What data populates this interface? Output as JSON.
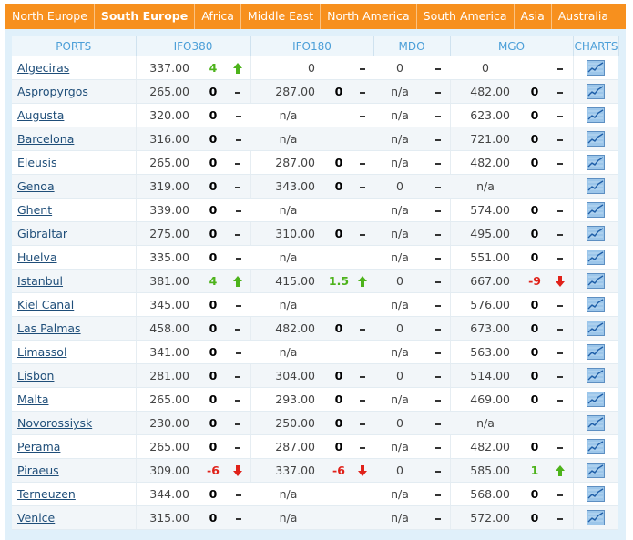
{
  "tabs": [
    "North Europe",
    "South Europe",
    "Africa",
    "Middle East",
    "North America",
    "South America",
    "Asia",
    "Australia"
  ],
  "active_tab": "South Europe",
  "headers": {
    "ports": "PORTS",
    "ifo380": "IFO380",
    "ifo180": "IFO180",
    "mdo": "MDO",
    "mgo": "MGO",
    "charts": "CHARTS"
  },
  "colors": {
    "tab_bg": "#f7901e",
    "panel_bg": "#e0f0fa",
    "up": "#4db31b",
    "down": "#e0221a",
    "header_text": "#4c9fd8"
  },
  "rows": [
    {
      "port": "Algeciras",
      "ifo380": {
        "price": "337.00",
        "chg": "4",
        "dir": "up"
      },
      "ifo180": {
        "price": "0",
        "chg": "",
        "dir": "dash"
      },
      "mdo": {
        "price": "0",
        "chg": "",
        "dir": "dash"
      },
      "mgo": {
        "price": "0",
        "chg": "",
        "dir": "dash"
      }
    },
    {
      "port": "Aspropyrgos",
      "ifo380": {
        "price": "265.00",
        "chg": "0",
        "dir": "dash"
      },
      "ifo180": {
        "price": "287.00",
        "chg": "0",
        "dir": "dash"
      },
      "mdo": {
        "price": "n/a",
        "chg": "",
        "dir": "dash"
      },
      "mgo": {
        "price": "482.00",
        "chg": "0",
        "dir": "dash"
      }
    },
    {
      "port": "Augusta",
      "ifo380": {
        "price": "320.00",
        "chg": "0",
        "dir": "dash"
      },
      "ifo180": {
        "price": "n/a",
        "chg": "",
        "dir": "dash"
      },
      "mdo": {
        "price": "n/a",
        "chg": "",
        "dir": "dash"
      },
      "mgo": {
        "price": "623.00",
        "chg": "0",
        "dir": "dash"
      }
    },
    {
      "port": "Barcelona",
      "ifo380": {
        "price": "316.00",
        "chg": "0",
        "dir": "dash"
      },
      "ifo180": {
        "price": "n/a",
        "chg": "",
        "dir": "none"
      },
      "mdo": {
        "price": "n/a",
        "chg": "",
        "dir": "dash"
      },
      "mgo": {
        "price": "721.00",
        "chg": "0",
        "dir": "dash"
      }
    },
    {
      "port": "Eleusis",
      "ifo380": {
        "price": "265.00",
        "chg": "0",
        "dir": "dash"
      },
      "ifo180": {
        "price": "287.00",
        "chg": "0",
        "dir": "dash"
      },
      "mdo": {
        "price": "n/a",
        "chg": "",
        "dir": "dash"
      },
      "mgo": {
        "price": "482.00",
        "chg": "0",
        "dir": "dash"
      }
    },
    {
      "port": "Genoa",
      "ifo380": {
        "price": "319.00",
        "chg": "0",
        "dir": "dash"
      },
      "ifo180": {
        "price": "343.00",
        "chg": "0",
        "dir": "dash"
      },
      "mdo": {
        "price": "0",
        "chg": "",
        "dir": "dash"
      },
      "mgo": {
        "price": "n/a",
        "chg": "",
        "dir": "none"
      }
    },
    {
      "port": "Ghent",
      "ifo380": {
        "price": "339.00",
        "chg": "0",
        "dir": "dash"
      },
      "ifo180": {
        "price": "n/a",
        "chg": "",
        "dir": "none"
      },
      "mdo": {
        "price": "n/a",
        "chg": "",
        "dir": "dash"
      },
      "mgo": {
        "price": "574.00",
        "chg": "0",
        "dir": "dash"
      }
    },
    {
      "port": "Gibraltar",
      "ifo380": {
        "price": "275.00",
        "chg": "0",
        "dir": "dash"
      },
      "ifo180": {
        "price": "310.00",
        "chg": "0",
        "dir": "dash"
      },
      "mdo": {
        "price": "n/a",
        "chg": "",
        "dir": "dash"
      },
      "mgo": {
        "price": "495.00",
        "chg": "0",
        "dir": "dash"
      }
    },
    {
      "port": "Huelva",
      "ifo380": {
        "price": "335.00",
        "chg": "0",
        "dir": "dash"
      },
      "ifo180": {
        "price": "n/a",
        "chg": "",
        "dir": "none"
      },
      "mdo": {
        "price": "n/a",
        "chg": "",
        "dir": "dash"
      },
      "mgo": {
        "price": "551.00",
        "chg": "0",
        "dir": "dash"
      }
    },
    {
      "port": "Istanbul",
      "ifo380": {
        "price": "381.00",
        "chg": "4",
        "dir": "up"
      },
      "ifo180": {
        "price": "415.00",
        "chg": "1.5",
        "dir": "up"
      },
      "mdo": {
        "price": "0",
        "chg": "",
        "dir": "dash"
      },
      "mgo": {
        "price": "667.00",
        "chg": "-9",
        "dir": "down"
      }
    },
    {
      "port": "Kiel Canal",
      "ifo380": {
        "price": "345.00",
        "chg": "0",
        "dir": "dash"
      },
      "ifo180": {
        "price": "n/a",
        "chg": "",
        "dir": "none"
      },
      "mdo": {
        "price": "n/a",
        "chg": "",
        "dir": "dash"
      },
      "mgo": {
        "price": "576.00",
        "chg": "0",
        "dir": "dash"
      }
    },
    {
      "port": "Las Palmas",
      "ifo380": {
        "price": "458.00",
        "chg": "0",
        "dir": "dash"
      },
      "ifo180": {
        "price": "482.00",
        "chg": "0",
        "dir": "dash"
      },
      "mdo": {
        "price": "0",
        "chg": "",
        "dir": "dash"
      },
      "mgo": {
        "price": "673.00",
        "chg": "0",
        "dir": "dash"
      }
    },
    {
      "port": "Limassol",
      "ifo380": {
        "price": "341.00",
        "chg": "0",
        "dir": "dash"
      },
      "ifo180": {
        "price": "n/a",
        "chg": "",
        "dir": "none"
      },
      "mdo": {
        "price": "n/a",
        "chg": "",
        "dir": "dash"
      },
      "mgo": {
        "price": "563.00",
        "chg": "0",
        "dir": "dash"
      }
    },
    {
      "port": "Lisbon",
      "ifo380": {
        "price": "281.00",
        "chg": "0",
        "dir": "dash"
      },
      "ifo180": {
        "price": "304.00",
        "chg": "0",
        "dir": "dash"
      },
      "mdo": {
        "price": "0",
        "chg": "",
        "dir": "dash"
      },
      "mgo": {
        "price": "514.00",
        "chg": "0",
        "dir": "dash"
      }
    },
    {
      "port": "Malta",
      "ifo380": {
        "price": "265.00",
        "chg": "0",
        "dir": "dash"
      },
      "ifo180": {
        "price": "293.00",
        "chg": "0",
        "dir": "dash"
      },
      "mdo": {
        "price": "n/a",
        "chg": "",
        "dir": "dash"
      },
      "mgo": {
        "price": "469.00",
        "chg": "0",
        "dir": "dash"
      }
    },
    {
      "port": "Novorossiysk",
      "ifo380": {
        "price": "230.00",
        "chg": "0",
        "dir": "dash"
      },
      "ifo180": {
        "price": "250.00",
        "chg": "0",
        "dir": "dash"
      },
      "mdo": {
        "price": "0",
        "chg": "",
        "dir": "dash"
      },
      "mgo": {
        "price": "n/a",
        "chg": "",
        "dir": "none"
      }
    },
    {
      "port": "Perama",
      "ifo380": {
        "price": "265.00",
        "chg": "0",
        "dir": "dash"
      },
      "ifo180": {
        "price": "287.00",
        "chg": "0",
        "dir": "dash"
      },
      "mdo": {
        "price": "n/a",
        "chg": "",
        "dir": "dash"
      },
      "mgo": {
        "price": "482.00",
        "chg": "0",
        "dir": "dash"
      }
    },
    {
      "port": "Piraeus",
      "ifo380": {
        "price": "309.00",
        "chg": "-6",
        "dir": "down"
      },
      "ifo180": {
        "price": "337.00",
        "chg": "-6",
        "dir": "down"
      },
      "mdo": {
        "price": "0",
        "chg": "",
        "dir": "dash"
      },
      "mgo": {
        "price": "585.00",
        "chg": "1",
        "dir": "up"
      }
    },
    {
      "port": "Terneuzen",
      "ifo380": {
        "price": "344.00",
        "chg": "0",
        "dir": "dash"
      },
      "ifo180": {
        "price": "n/a",
        "chg": "",
        "dir": "none"
      },
      "mdo": {
        "price": "n/a",
        "chg": "",
        "dir": "dash"
      },
      "mgo": {
        "price": "568.00",
        "chg": "0",
        "dir": "dash"
      }
    },
    {
      "port": "Venice",
      "ifo380": {
        "price": "315.00",
        "chg": "0",
        "dir": "dash"
      },
      "ifo180": {
        "price": "n/a",
        "chg": "",
        "dir": "none"
      },
      "mdo": {
        "price": "n/a",
        "chg": "",
        "dir": "dash"
      },
      "mgo": {
        "price": "572.00",
        "chg": "0",
        "dir": "dash"
      }
    }
  ]
}
